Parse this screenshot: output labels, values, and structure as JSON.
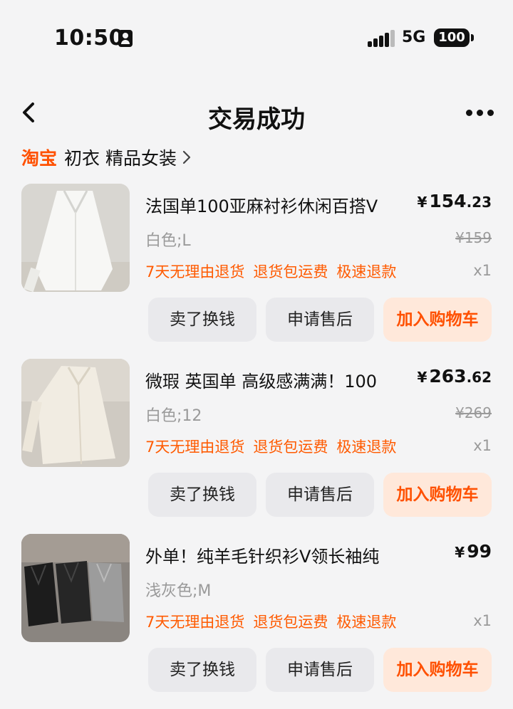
{
  "status": {
    "time": "10:50",
    "network": "5G",
    "battery": "100"
  },
  "nav": {
    "title": "交易成功"
  },
  "shop": {
    "brand": "淘宝",
    "name": "初衣 精品女装"
  },
  "buttons": {
    "sell": "卖了换钱",
    "after_sale": "申请售后",
    "add_cart": "加入购物车"
  },
  "items": [
    {
      "title": "法国单100亚麻衬衫休闲百搭V",
      "currency": "¥",
      "price_int": "154",
      "price_dec": ".23",
      "variant": "白色;L",
      "original_price": "¥159",
      "services": [
        "7天无理由退货",
        "退货包运费",
        "极速退款"
      ],
      "qty": "x1"
    },
    {
      "title": "微瑕 英国单 高级感满满！100",
      "currency": "¥",
      "price_int": "263",
      "price_dec": ".62",
      "variant": "白色;12",
      "original_price": "¥269",
      "services": [
        "7天无理由退货",
        "退货包运费",
        "极速退款"
      ],
      "qty": "x1"
    },
    {
      "title": "外单！纯羊毛针织衫V领长袖纯",
      "currency": "¥",
      "price_int": "99",
      "price_dec": "",
      "variant": "浅灰色;M",
      "original_price": "",
      "services": [
        "7天无理由退货",
        "退货包运费",
        "极速退款"
      ],
      "qty": "x1"
    }
  ],
  "colors": {
    "accent": "#ff5000",
    "button_gray": "#e9e9ec",
    "button_orange_bg": "#ffe8da",
    "muted": "#9a9a9a"
  }
}
